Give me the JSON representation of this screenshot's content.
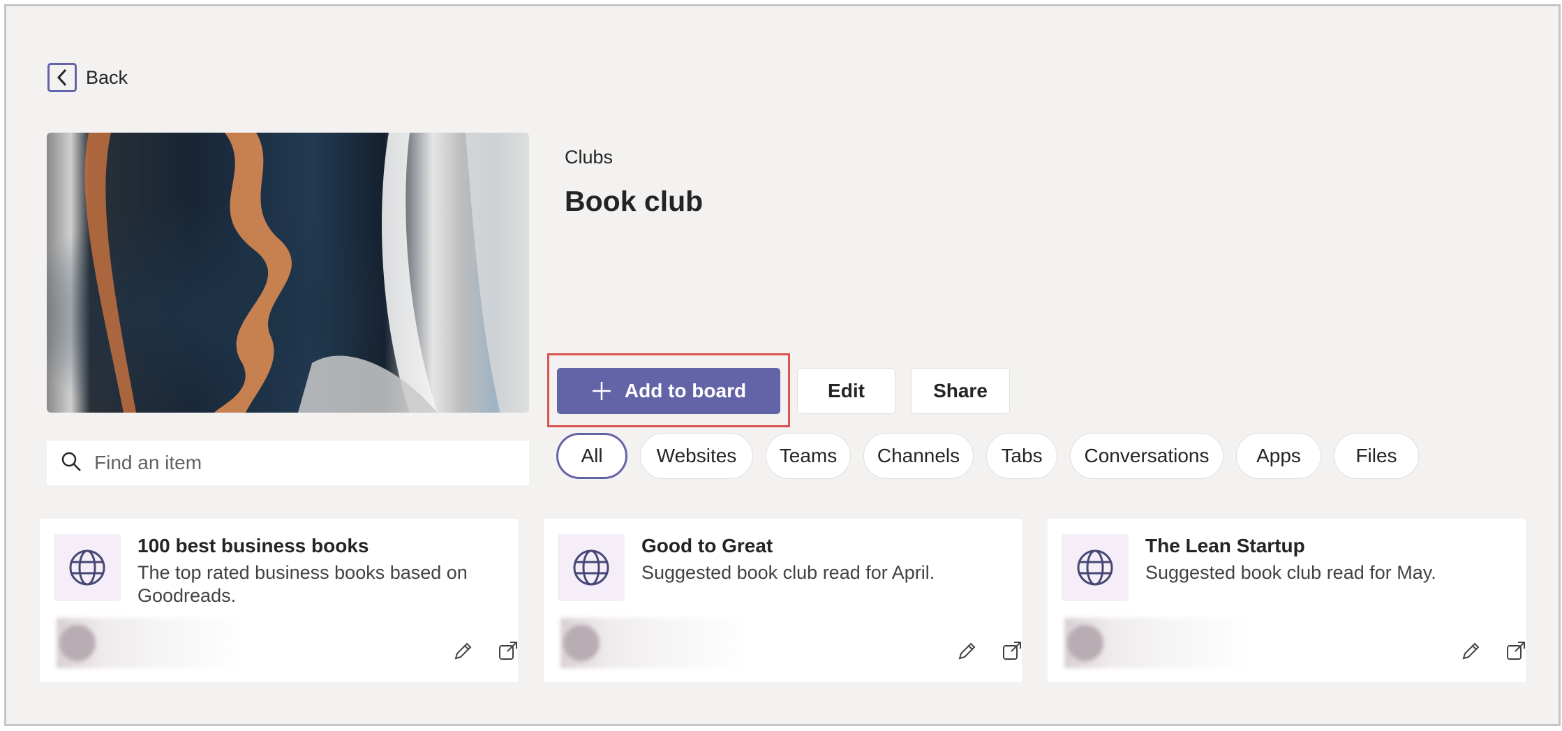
{
  "back": {
    "label": "Back"
  },
  "board": {
    "category": "Clubs",
    "title": "Book club"
  },
  "actions": {
    "add_label": "Add to board",
    "edit_label": "Edit",
    "share_label": "Share"
  },
  "search": {
    "placeholder": "Find an item"
  },
  "filters": [
    "All",
    "Websites",
    "Teams",
    "Channels",
    "Tabs",
    "Conversations",
    "Apps",
    "Files"
  ],
  "selected_filter": "All",
  "cards": [
    {
      "title": "100 best business books",
      "description": "The top rated business books based on Goodreads.",
      "icon": "globe-icon"
    },
    {
      "title": "Good to Great",
      "description": "Suggested book club read for April.",
      "icon": "globe-icon"
    },
    {
      "title": "The Lean Startup",
      "description": "Suggested book club read for May.",
      "icon": "globe-icon"
    }
  ],
  "colors": {
    "accent": "#6264a7",
    "background": "#f3f2f1",
    "highlight": "#d9534f",
    "icon_tile": "#f5eef8",
    "icon": "#464775"
  }
}
